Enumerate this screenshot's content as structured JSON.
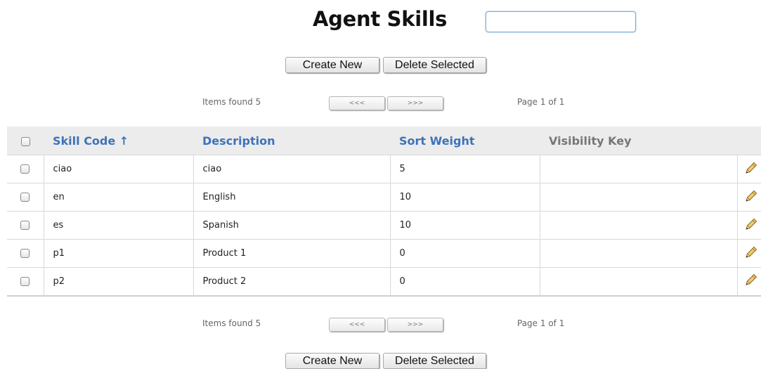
{
  "page": {
    "title": "Agent Skills"
  },
  "search": {
    "value": "",
    "placeholder": ""
  },
  "toolbar": {
    "create_label": "Create New",
    "delete_label": "Delete Selected"
  },
  "pager": {
    "items_found": "Items found 5",
    "prev_label": "<<<",
    "next_label": ">>>",
    "page_info": "Page 1 of 1"
  },
  "table": {
    "columns": [
      {
        "label": "Skill Code ↑"
      },
      {
        "label": "Description"
      },
      {
        "label": "Sort Weight"
      },
      {
        "label": "Visibility Key"
      }
    ],
    "rows": [
      {
        "code": "ciao",
        "description": "ciao",
        "weight": "5",
        "visibility": ""
      },
      {
        "code": "en",
        "description": "English",
        "weight": "10",
        "visibility": ""
      },
      {
        "code": "es",
        "description": "Spanish",
        "weight": "10",
        "visibility": ""
      },
      {
        "code": "p1",
        "description": "Product 1",
        "weight": "0",
        "visibility": ""
      },
      {
        "code": "p2",
        "description": "Product 2",
        "weight": "0",
        "visibility": ""
      }
    ]
  },
  "colors": {
    "header_link": "#3d73b8",
    "header_bg": "#ececec",
    "search_border": "#7aa7d6"
  },
  "icons": {
    "row_edit": "pencil-icon"
  }
}
